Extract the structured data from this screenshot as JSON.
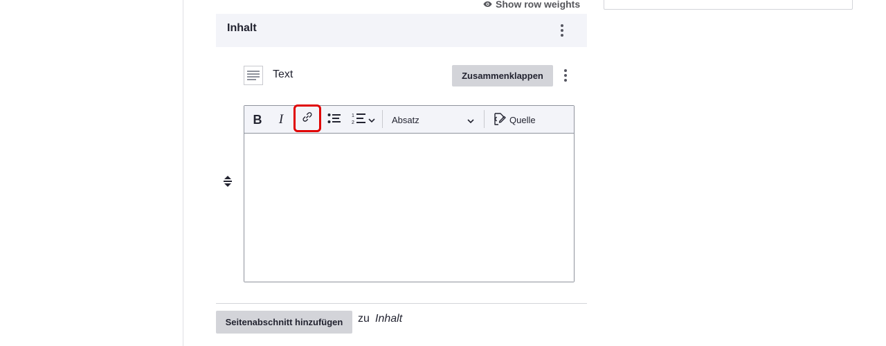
{
  "header": {
    "show_row_weights_label": "Show row weights"
  },
  "section": {
    "title": "Inhalt"
  },
  "paragraph": {
    "type_label": "Text",
    "collapse_label": "Zusammenklappen"
  },
  "editor": {
    "toolbar": {
      "bold_label": "B",
      "italic_label": "I",
      "heading_selected": "Absatz",
      "source_label": "Quelle"
    },
    "content": ""
  },
  "footer": {
    "add_section_label": "Seitenabschnitt hinzufügen",
    "to_label": "zu",
    "region_label": "Inhalt"
  },
  "colors": {
    "highlight": "#e00000",
    "button_gray": "#d3d4d9",
    "header_bg": "#f3f4f9",
    "text": "#222330"
  }
}
